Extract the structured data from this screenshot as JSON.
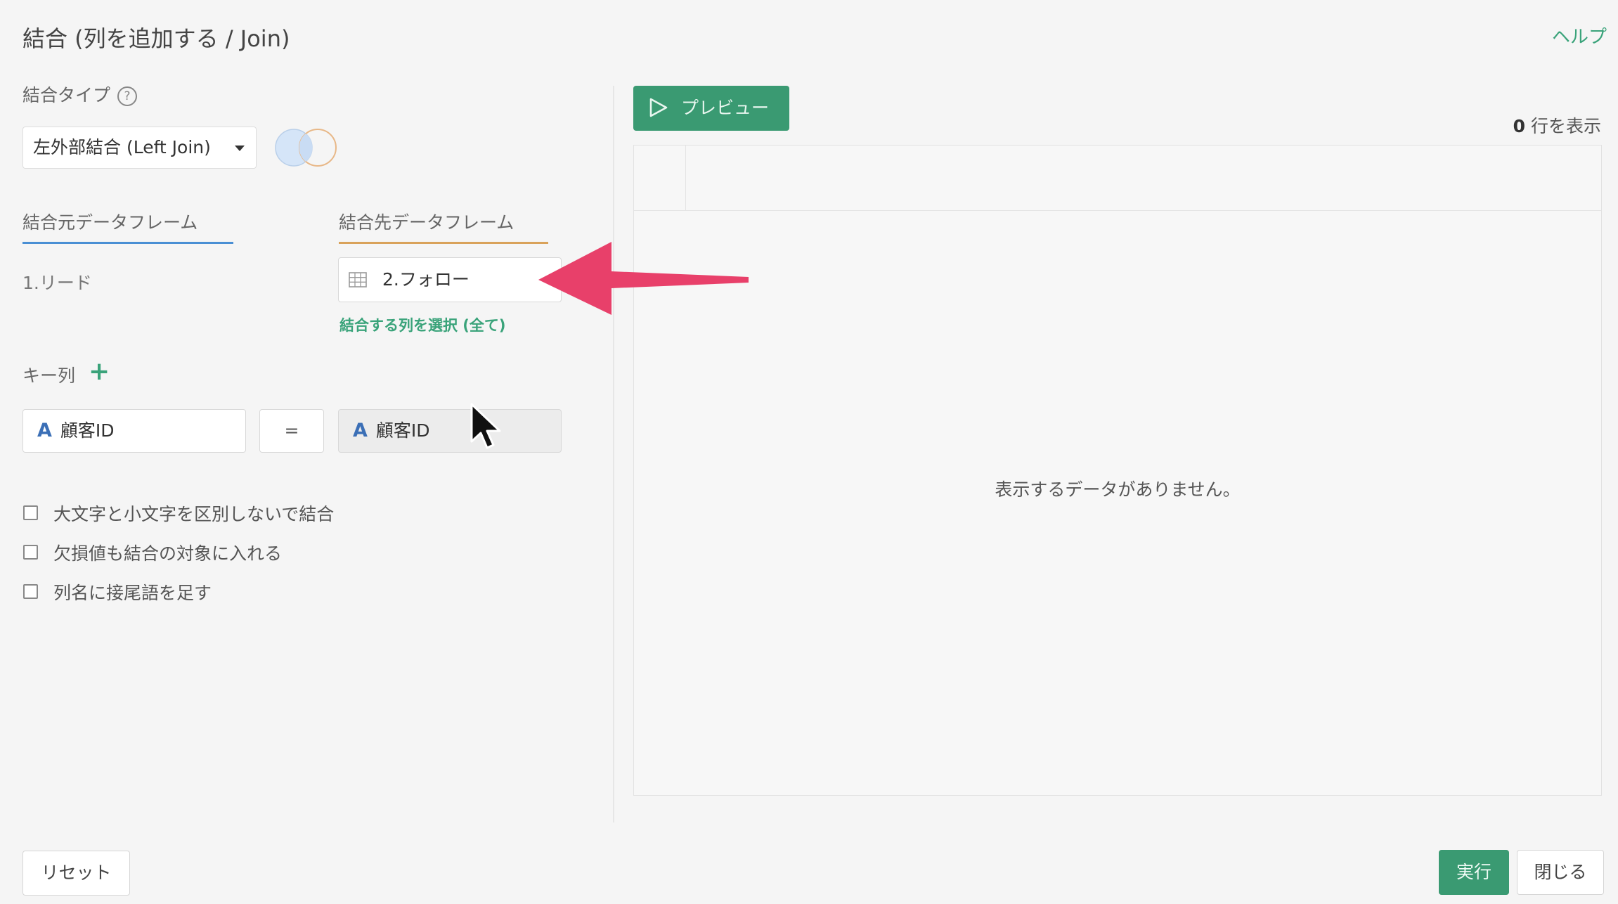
{
  "header": {
    "title": "結合 (列を追加する / Join)",
    "help_link": "ヘルプ"
  },
  "join_type": {
    "label": "結合タイプ",
    "help_icon": "?",
    "selected": "左外部結合 (Left Join)"
  },
  "dataframes": {
    "source_tab": "結合元データフレーム",
    "target_tab": "結合先データフレーム",
    "source_name": "1.リード",
    "target_name": "2.フォロー",
    "select_columns_link": "結合する列を選択 (全て)",
    "source_tab_color": "#4a8fd4",
    "target_tab_color": "#d9a25a"
  },
  "key_columns": {
    "label": "キー列",
    "add_icon": "+",
    "left": {
      "type_icon": "A",
      "name": "顧客ID"
    },
    "operator": "=",
    "right": {
      "type_icon": "A",
      "name": "顧客ID"
    }
  },
  "options": [
    {
      "label": "大文字と小文字を区別しないで結合",
      "checked": false
    },
    {
      "label": "欠損値も結合の対象に入れる",
      "checked": false
    },
    {
      "label": "列名に接尾語を足す",
      "checked": false
    }
  ],
  "preview": {
    "button_label": "プレビュー",
    "row_count": "0",
    "row_count_suffix": " 行を表示",
    "empty_message": "表示するデータがありません。"
  },
  "footer": {
    "reset_label": "リセット",
    "run_label": "実行",
    "close_label": "閉じる"
  },
  "colors": {
    "accent_green": "#3a9a72",
    "annotation_arrow": "#e8406a"
  }
}
